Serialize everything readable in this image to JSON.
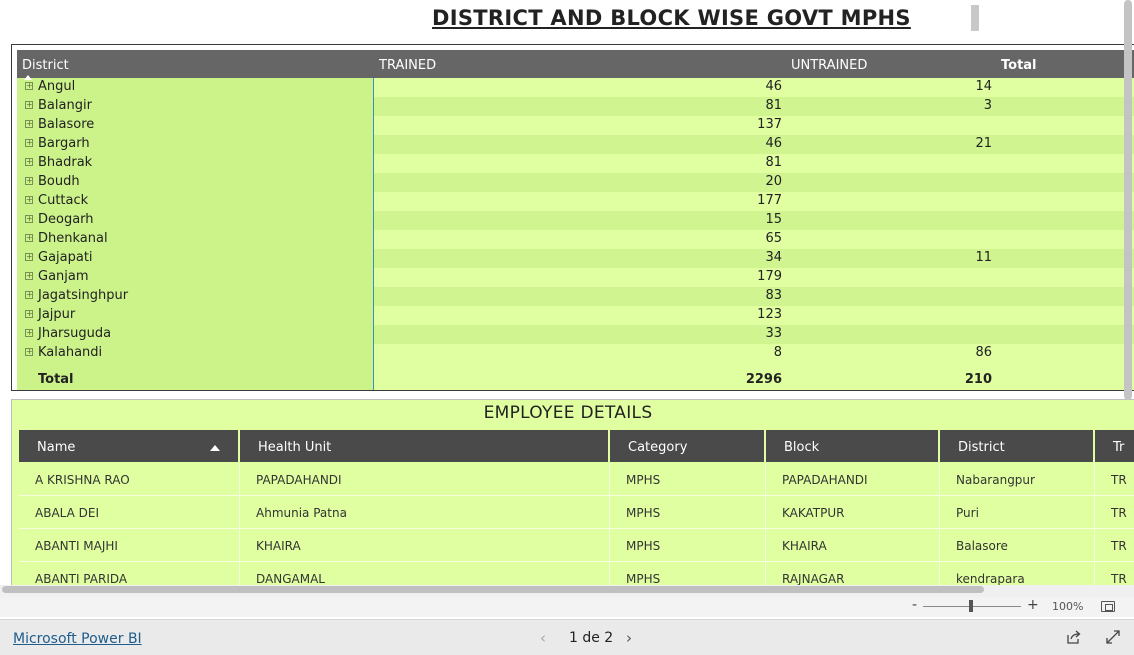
{
  "report": {
    "title": "DISTRICT AND BLOCK WISE GOVT MPHS"
  },
  "matrix": {
    "columns": {
      "district": "District",
      "trained": "TRAINED",
      "untrained": "UNTRAINED",
      "total": "Total"
    },
    "rows": [
      {
        "name": "Angul",
        "trained": "46",
        "untrained": "14"
      },
      {
        "name": "Balangir",
        "trained": "81",
        "untrained": "3"
      },
      {
        "name": "Balasore",
        "trained": "137",
        "untrained": ""
      },
      {
        "name": "Bargarh",
        "trained": "46",
        "untrained": "21"
      },
      {
        "name": "Bhadrak",
        "trained": "81",
        "untrained": ""
      },
      {
        "name": "Boudh",
        "trained": "20",
        "untrained": ""
      },
      {
        "name": "Cuttack",
        "trained": "177",
        "untrained": ""
      },
      {
        "name": "Deogarh",
        "trained": "15",
        "untrained": ""
      },
      {
        "name": "Dhenkanal",
        "trained": "65",
        "untrained": ""
      },
      {
        "name": "Gajapati",
        "trained": "34",
        "untrained": "11"
      },
      {
        "name": "Ganjam",
        "trained": "179",
        "untrained": ""
      },
      {
        "name": "Jagatsinghpur",
        "trained": "83",
        "untrained": ""
      },
      {
        "name": "Jajpur",
        "trained": "123",
        "untrained": ""
      },
      {
        "name": "Jharsuguda",
        "trained": "33",
        "untrained": ""
      },
      {
        "name": "Kalahandi",
        "trained": "8",
        "untrained": "86"
      }
    ],
    "total": {
      "label": "Total",
      "trained": "2296",
      "untrained": "210"
    }
  },
  "employees": {
    "title": "EMPLOYEE DETAILS",
    "columns": [
      "Name",
      "Health Unit",
      "Category",
      "Block",
      "District",
      "Tr"
    ],
    "rows": [
      [
        "A KRISHNA RAO",
        "PAPADAHANDI",
        "MPHS",
        "PAPADAHANDI",
        "Nabarangpur",
        "TR"
      ],
      [
        "ABALA DEI",
        "Ahmunia Patna",
        "MPHS",
        "KAKATPUR",
        "Puri",
        "TR"
      ],
      [
        "ABANTI MAJHI",
        "KHAIRA",
        "MPHS",
        "KHAIRA",
        "Balasore",
        "TR"
      ],
      [
        "ABANTI PARIDA",
        "DANGAMAL",
        "MPHS",
        "RAJNAGAR",
        "kendrapara",
        "TR"
      ]
    ]
  },
  "zoom": {
    "minus": "-",
    "plus": "+",
    "level": "100%"
  },
  "footer": {
    "brand_link": "Microsoft Power BI",
    "prev": "‹",
    "page_label": "1 de 2",
    "next": "›"
  },
  "colors": {
    "row_light": "#e0ffa0",
    "row_dark": "#d0f590",
    "header_bg": "#666666",
    "table_header_bg": "#4a4a4a"
  }
}
